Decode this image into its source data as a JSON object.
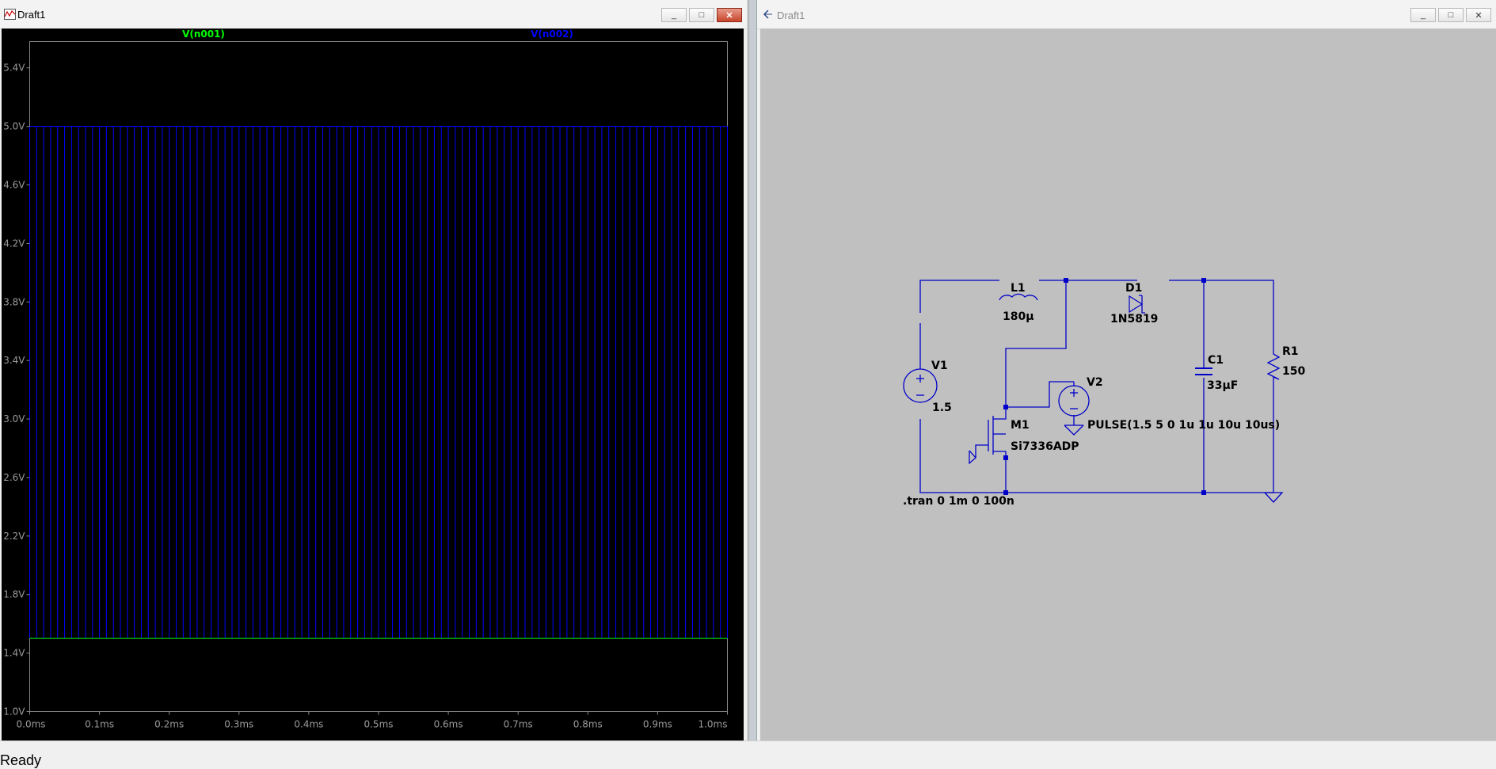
{
  "plot_window": {
    "title": "Draft1",
    "buttons": {
      "minimize": "_",
      "maximize": "□",
      "close": "✕"
    },
    "icon": "waveform-icon"
  },
  "schematic_window": {
    "title": "Draft1",
    "buttons": {
      "minimize": "_",
      "maximize": "□",
      "close": "✕"
    },
    "icon": "schematic-icon"
  },
  "chart_data": {
    "type": "line",
    "title": "",
    "xlabel": "",
    "ylabel": "",
    "x_ticks": [
      "0.0ms",
      "0.1ms",
      "0.2ms",
      "0.3ms",
      "0.4ms",
      "0.5ms",
      "0.6ms",
      "0.7ms",
      "0.8ms",
      "0.9ms",
      "1.0ms"
    ],
    "y_ticks": [
      "1.0V",
      "1.4V",
      "1.8V",
      "2.2V",
      "2.6V",
      "3.0V",
      "3.4V",
      "3.8V",
      "4.2V",
      "4.6V",
      "5.0V",
      "5.4V"
    ],
    "xlim": [
      0,
      1.0
    ],
    "ylim": [
      1.0,
      5.58
    ],
    "grid": false,
    "series": [
      {
        "name": "V(n001)",
        "color": "#00ff00",
        "kind": "dc",
        "value": 1.5
      },
      {
        "name": "V(n002)",
        "color": "#0000ff",
        "kind": "pulse",
        "low": 1.5,
        "high": 5.0,
        "delay_us": 0,
        "rise_us": 1,
        "fall_us": 1,
        "width_us": 10,
        "period_us": 10
      }
    ]
  },
  "schematic": {
    "L1": {
      "ref": "L1",
      "value": "180μ"
    },
    "D1": {
      "ref": "D1",
      "value": "1N5819"
    },
    "C1": {
      "ref": "C1",
      "value": "33μF"
    },
    "R1": {
      "ref": "R1",
      "value": "150"
    },
    "V1": {
      "ref": "V1",
      "value": "1.5"
    },
    "V2": {
      "ref": "V2",
      "value": "PULSE(1.5 5 0 1u 1u 10u 10us)"
    },
    "M1": {
      "ref": "M1",
      "value": "Si7336ADP"
    },
    "directive": ".tran 0 1m 0 100n",
    "wire_color": "#0000c8"
  },
  "status": {
    "text": "Ready"
  }
}
